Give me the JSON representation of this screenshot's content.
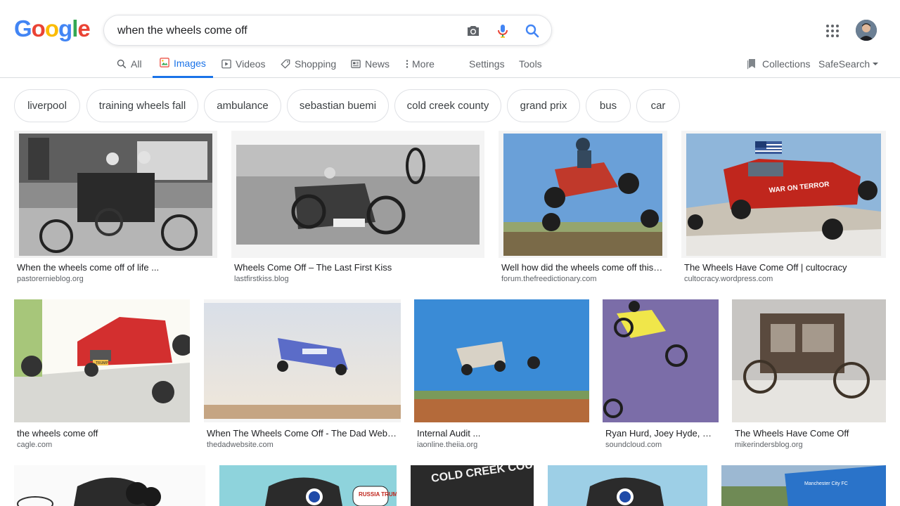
{
  "search": {
    "query": "when the wheels come off"
  },
  "logo": [
    "G",
    "o",
    "o",
    "g",
    "l",
    "e"
  ],
  "tabs": [
    {
      "label": "All",
      "icon": "search-icon"
    },
    {
      "label": "Images",
      "icon": "image-icon"
    },
    {
      "label": "Videos",
      "icon": "video-icon"
    },
    {
      "label": "Shopping",
      "icon": "tag-icon"
    },
    {
      "label": "News",
      "icon": "news-icon"
    },
    {
      "label": "More",
      "icon": "more-vertical-icon"
    },
    {
      "label": "Settings"
    },
    {
      "label": "Tools"
    }
  ],
  "right": {
    "collections": "Collections",
    "safesearch": "SafeSearch"
  },
  "chips": [
    "liverpool",
    "training wheels fall",
    "ambulance",
    "sebastian buemi",
    "cold creek county",
    "grand prix",
    "bus",
    "car"
  ],
  "results": [
    {
      "title": "When the wheels come off of life ...",
      "source": "pastorernieblog.org"
    },
    {
      "title": "Wheels Come Off – The Last First Kiss",
      "source": "lastfirstkiss.blog"
    },
    {
      "title": "Well how did the wheels come off this ...",
      "source": "forum.thefreedictionary.com"
    },
    {
      "title": "The Wheels Have Come Off | cultocracy",
      "source": "cultocracy.wordpress.com"
    },
    {
      "title": "the wheels come off",
      "source": "cagle.com"
    },
    {
      "title": "When The Wheels Come Off - The Dad Website",
      "source": "thedadwebsite.com"
    },
    {
      "title": "Internal Audit ...",
      "source": "iaonline.theiia.org"
    },
    {
      "title": "Ryan Hurd, Joey Hyde, Brent ...",
      "source": "soundcloud.com"
    },
    {
      "title": "The Wheels Have Come Off",
      "source": "mikerindersblog.org"
    }
  ],
  "image_text": {
    "war_on_terror": "WAR ON TERROR",
    "cold_creek": "COLD CREEK COUNTY",
    "russia_trump": "RUSSIA TRUMP",
    "trump_plate": "TRUMP",
    "bus_sign": "Manchester City FC"
  },
  "colors": {
    "accent": "#1a73e8",
    "muted": "#5f6368",
    "border": "#dfe1e5"
  }
}
